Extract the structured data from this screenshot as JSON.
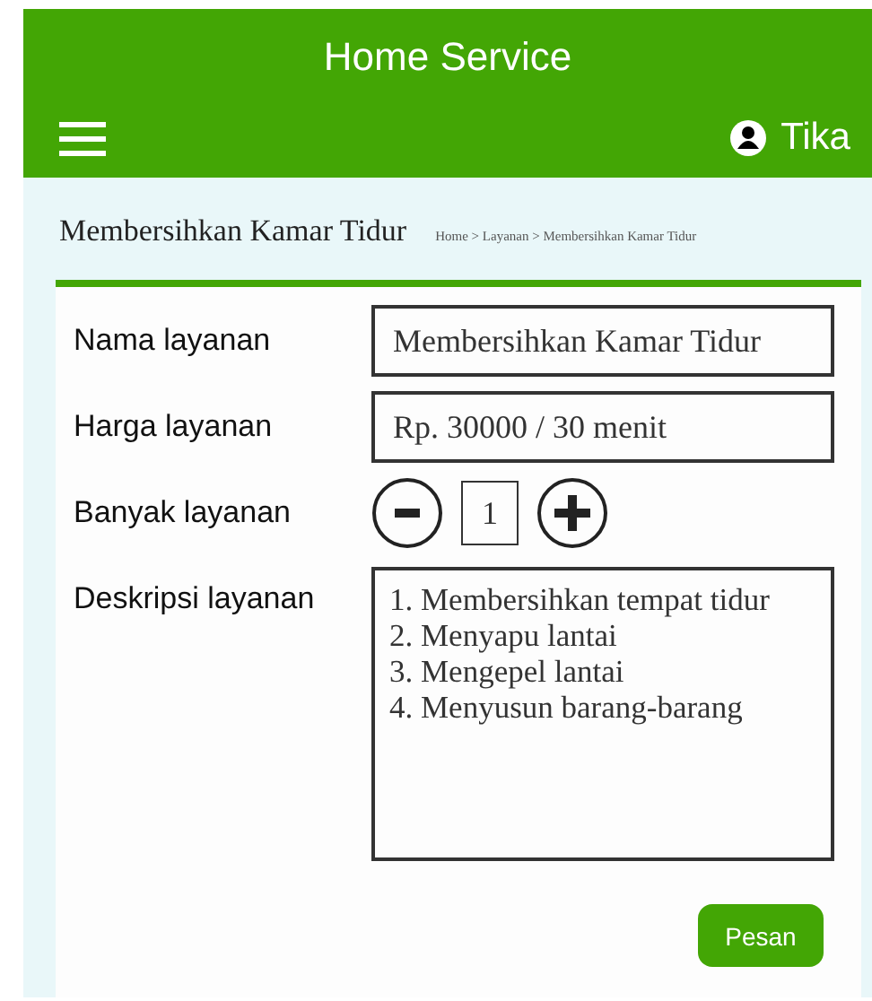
{
  "header": {
    "title": "Home Service",
    "user": "Tika"
  },
  "page": {
    "title": "Membersihkan Kamar Tidur",
    "breadcrumb": "Home > Layanan > Membersihkan Kamar Tidur"
  },
  "form": {
    "name_label": "Nama layanan",
    "name_value": "Membersihkan Kamar Tidur",
    "price_label": "Harga layanan",
    "price_value": "Rp. 30000 / 30 menit",
    "quantity_label": "Banyak layanan",
    "quantity_value": "1",
    "description_label": "Deskripsi layanan",
    "description_lines": [
      "1. Membersihkan tempat tidur",
      "2. Menyapu lantai",
      "3. Mengepel lantai",
      "4. Menyusun barang-barang"
    ],
    "submit": "Pesan"
  }
}
